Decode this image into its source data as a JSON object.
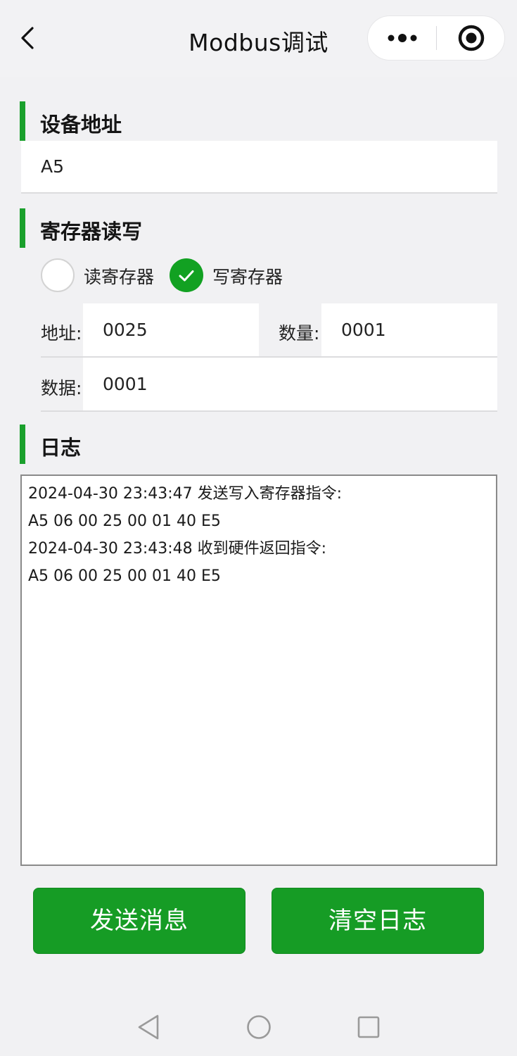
{
  "nav": {
    "title": "Modbus调试"
  },
  "device_section": {
    "title": "设备地址",
    "address_value": "A5"
  },
  "register_section": {
    "title": "寄存器读写",
    "options": [
      {
        "label": "读寄存器",
        "selected": false
      },
      {
        "label": "写寄存器",
        "selected": true
      }
    ],
    "address_label": "地址:",
    "address_value": "0025",
    "count_label": "数量:",
    "count_value": "0001",
    "data_label": "数据:",
    "data_value": "0001"
  },
  "log_section": {
    "title": "日志",
    "lines": [
      "2024-04-30 23:43:47 发送写入寄存器指令:",
      "A5 06 00 25 00 01 40 E5",
      "2024-04-30 23:43:48 收到硬件返回指令:",
      "A5 06 00 25 00 01 40 E5"
    ]
  },
  "actions": {
    "send_label": "发送消息",
    "clear_label": "清空日志"
  },
  "colors": {
    "accent": "#1aa02c",
    "button": "#169c25"
  },
  "icons": {
    "back": "chevron-left-icon",
    "more": "more-dots-icon",
    "close": "target-circle-icon",
    "check": "check-icon",
    "sys_back": "triangle-back-icon",
    "sys_home": "circle-home-icon",
    "sys_recent": "square-recent-icon"
  }
}
